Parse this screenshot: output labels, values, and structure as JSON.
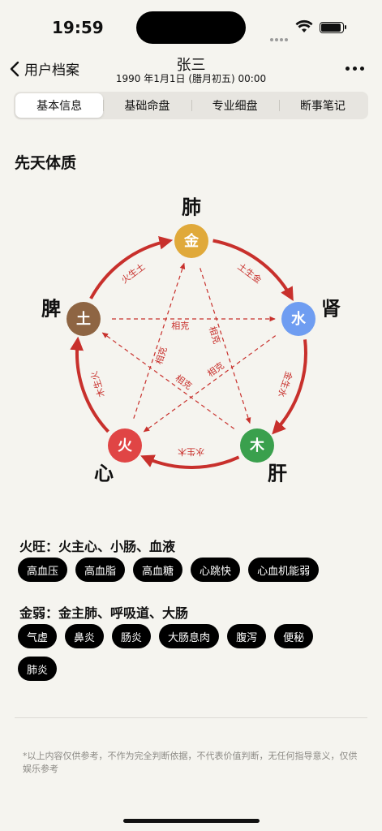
{
  "status": {
    "time": "19:59"
  },
  "nav": {
    "back_label": "用户档案",
    "title": "张三",
    "subtitle": "1990 年1月1日 (腊月初五) 00:00"
  },
  "tabs": [
    {
      "label": "基本信息",
      "active": true
    },
    {
      "label": "基础命盘",
      "active": false
    },
    {
      "label": "专业细盘",
      "active": false
    },
    {
      "label": "断事笔记",
      "active": false
    }
  ],
  "section_title": "先天体质",
  "diagram": {
    "nodes": [
      {
        "element": "金",
        "organ": "肺",
        "color": "#e0a93a"
      },
      {
        "element": "水",
        "organ": "肾",
        "color": "#6f9df1"
      },
      {
        "element": "木",
        "organ": "肝",
        "color": "#3aa04d"
      },
      {
        "element": "火",
        "organ": "心",
        "color": "#e04545"
      },
      {
        "element": "土",
        "organ": "脾",
        "color": "#8e6543"
      }
    ],
    "generating": [
      "土生金",
      "金生水",
      "水生木",
      "木生火",
      "火生土"
    ],
    "controlling_label": "相克",
    "arrow_color": "#c8302c"
  },
  "groups": [
    {
      "title": "火旺：火主心、小肠、血液",
      "tags": [
        "高血压",
        "高血脂",
        "高血糖",
        "心跳快",
        "心血机能弱"
      ]
    },
    {
      "title": "金弱：金主肺、呼吸道、大肠",
      "tags": [
        "气虚",
        "鼻炎",
        "肠炎",
        "大肠息肉",
        "腹泻",
        "便秘",
        "肺炎"
      ]
    }
  ],
  "disclaimer": "*以上内容仅供参考，不作为完全判断依据，不代表价值判断，无任何指导意义，仅供娱乐参考"
}
